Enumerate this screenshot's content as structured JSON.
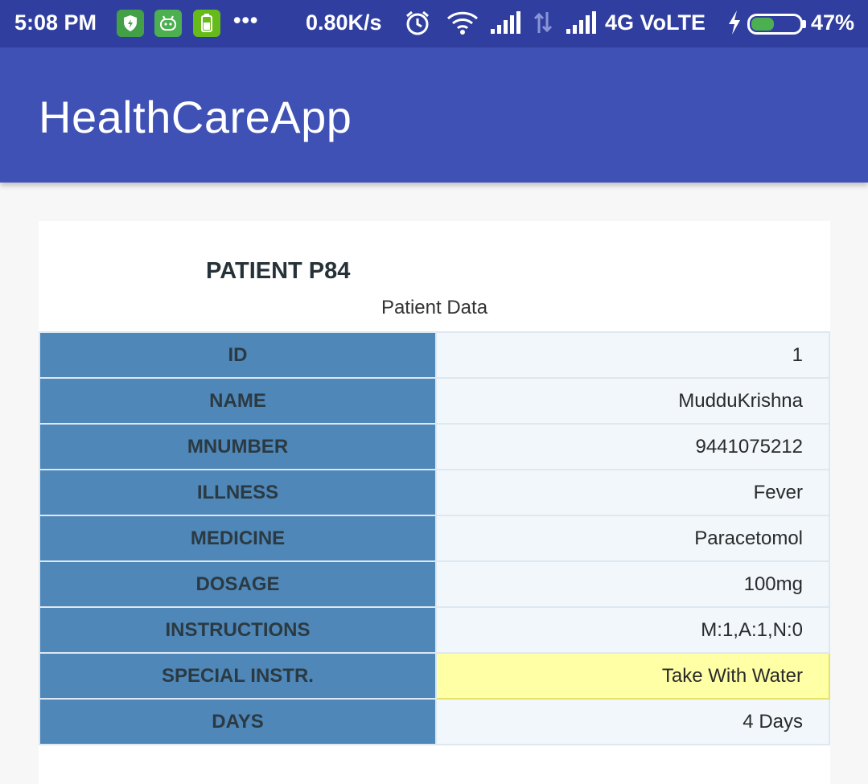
{
  "status_bar": {
    "time": "5:08 PM",
    "more": "•••",
    "net_speed": "0.80K/s",
    "network": "4G VoLTE",
    "battery_pct": "47%",
    "battery_level": 0.47,
    "icons": [
      "shield-icon",
      "android-icon",
      "battery-app-icon",
      "alarm-icon",
      "wifi-icon",
      "signal-icon",
      "data-transfer-icon",
      "signal-icon",
      "charging-icon",
      "battery-icon"
    ],
    "colors": {
      "background": "#303f9f",
      "app_icons": "#4caf50"
    }
  },
  "app_bar": {
    "title": "HealthCareApp",
    "color": "#3f51b5"
  },
  "card": {
    "patient_title": "PATIENT P84",
    "caption": "Patient Data",
    "rows": [
      {
        "label": "ID",
        "value": "1"
      },
      {
        "label": "NAME",
        "value": "MudduKrishna"
      },
      {
        "label": "MNUMBER",
        "value": "9441075212"
      },
      {
        "label": "ILLNESS",
        "value": "Fever"
      },
      {
        "label": "MEDICINE",
        "value": "Paracetomol"
      },
      {
        "label": "DOSAGE",
        "value": "100mg"
      },
      {
        "label": "INSTRUCTIONS",
        "value": "M:1,A:1,N:0"
      },
      {
        "label": "SPECIAL INSTR.",
        "value": "Take With Water",
        "highlight": true
      },
      {
        "label": "DAYS",
        "value": "4 Days"
      }
    ],
    "colors": {
      "key_cell": "#4f87b8",
      "value_cell": "#f2f7fb",
      "highlight_cell": "#ffffa6"
    }
  }
}
